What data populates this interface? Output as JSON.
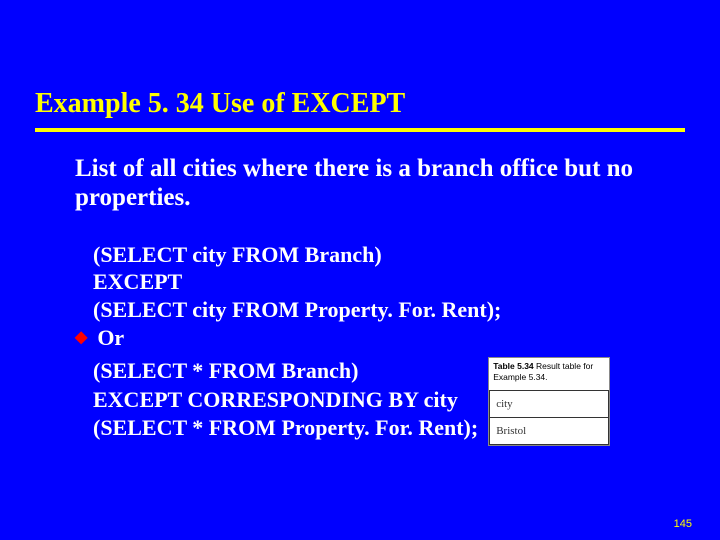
{
  "title": "Example 5. 34  Use of EXCEPT",
  "lead": "List of all cities where there is a branch office but no  properties.",
  "code1": {
    "l1": "(SELECT city FROM Branch)",
    "l2": "EXCEPT",
    "l3": "(SELECT city FROM Property. For. Rent);"
  },
  "or_label": "Or",
  "code2": {
    "l1": "(SELECT * FROM Branch)",
    "l2": "EXCEPT CORRESPONDING BY city",
    "l3": "(SELECT * FROM Property. For. Rent);"
  },
  "result_table": {
    "caption_bold": "Table 5.34",
    "caption_rest": " Result table for Example 5.34.",
    "header": "city",
    "row1": "Bristol"
  },
  "page_number": "145"
}
